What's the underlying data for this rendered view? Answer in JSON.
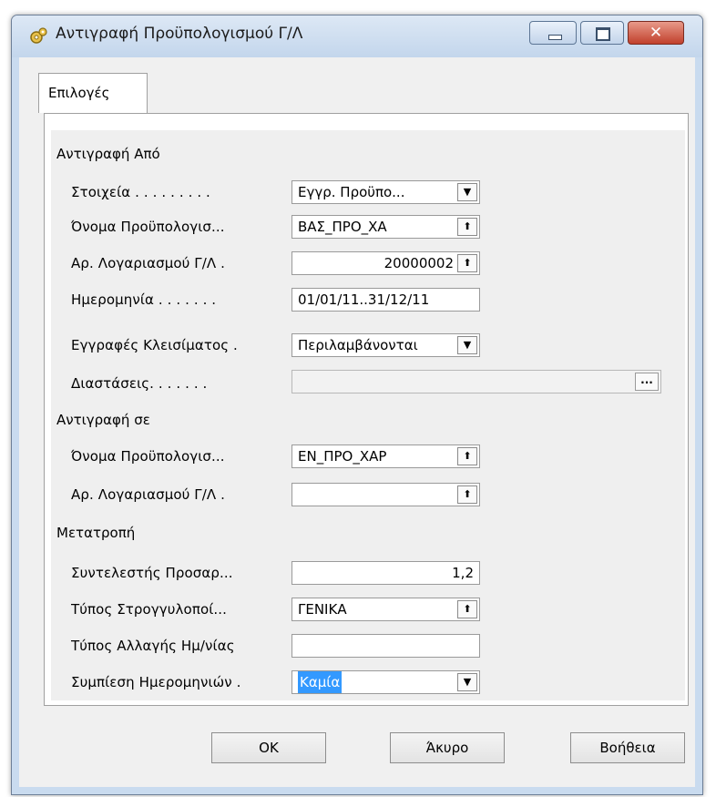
{
  "window": {
    "title": "Αντιγραφή Προϋπολογισμού Γ/Λ",
    "close_glyph": "✕"
  },
  "tabs": [
    {
      "label": "Επιλογές"
    }
  ],
  "sections": {
    "copy_from": "Αντιγραφή Από",
    "copy_to": "Αντιγραφή σε",
    "conversion": "Μετατροπή"
  },
  "fields": {
    "stoixeia": {
      "label": "Στοιχεία . . . . . . . . .",
      "value": "Εγγρ. Προϋπο...",
      "icon": "dropdown-arrow"
    },
    "budget_name_from": {
      "label": "Όνομα Προϋπολογισ...",
      "value": "ΒΑΣ_ΠΡΟ_ΧΑ",
      "icon": "lookup-arrow"
    },
    "gl_account_from": {
      "label": "Αρ. Λογαριασμού Γ/Λ  .",
      "value": "20000002",
      "icon": "lookup-arrow"
    },
    "date": {
      "label": "Ημερομηνία . . . . . . .",
      "value": "01/01/11..31/12/11"
    },
    "closing_entries": {
      "label": "Εγγραφές Κλεισίματος .",
      "value": "Περιλαμβάνονται",
      "icon": "dropdown-arrow"
    },
    "dimensions": {
      "label": "Διαστάσεις. . . . . . .",
      "value": "",
      "button": "..."
    },
    "budget_name_to": {
      "label": "Όνομα Προϋπολογισ...",
      "value": "ΕΝ_ΠΡΟ_ΧΑΡ",
      "icon": "lookup-arrow"
    },
    "gl_account_to": {
      "label": "Αρ. Λογαριασμού Γ/Λ  .",
      "value": "",
      "icon": "lookup-arrow"
    },
    "adjustment_factor": {
      "label": "Συντελεστής Προσαρ...",
      "value": "1,2"
    },
    "rounding_type": {
      "label": "Τύπος Στρογγυλοποί...",
      "value": "ΓΕΝΙΚΑ",
      "icon": "lookup-arrow"
    },
    "date_change_type": {
      "label": "Τύπος Αλλαγής Ημ/νίας",
      "value": ""
    },
    "date_compression": {
      "label": "Συμπίεση Ημερομηνιών .",
      "value": "Καμία",
      "icon": "dropdown-arrow"
    }
  },
  "glyphs": {
    "dropdown": "▼",
    "lookup": "⬆"
  },
  "buttons": {
    "ok": "OK",
    "cancel": "Άκυρο",
    "help": "Βοήθεια"
  },
  "colors": {
    "titlebar": "#c9dbef",
    "selection": "#3399ff",
    "close_button": "#c1402c"
  }
}
